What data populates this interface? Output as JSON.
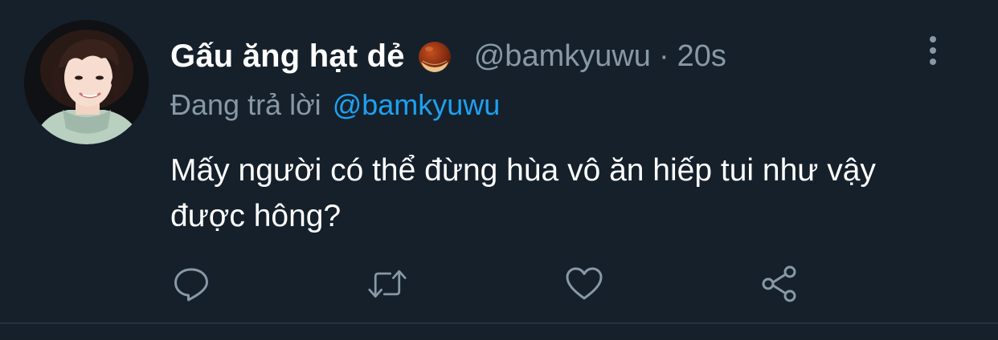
{
  "tweet": {
    "display_name": "Gấu ăng hạt dẻ",
    "name_emoji": "chestnut-icon",
    "handle": "@bamkyuwu",
    "separator": "·",
    "time": "20s",
    "reply_prefix": "Đang trả lời",
    "reply_mention": "@bamkyuwu",
    "text": "Mấy người có thể đừng hùa vô ăn hiếp tui như vậy được hông?"
  },
  "actions": {
    "reply_icon": "reply-icon",
    "retweet_icon": "retweet-icon",
    "like_icon": "like-icon",
    "share_icon": "share-icon"
  },
  "colors": {
    "background": "#15202b",
    "primary_text": "#ffffff",
    "secondary_text": "#8899a6",
    "accent": "#1da1f2",
    "divider": "#253341"
  }
}
